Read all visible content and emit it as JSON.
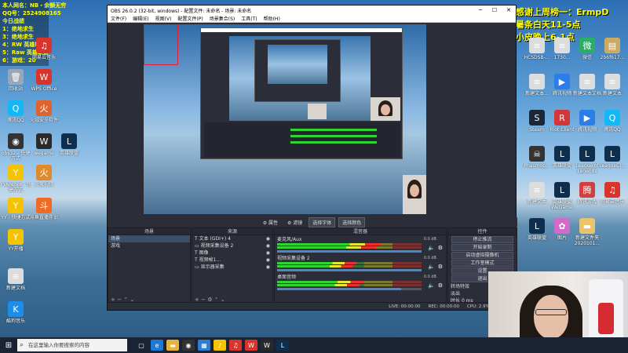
{
  "overlay_left": [
    "本人网名：NB・余额无穷",
    "QQ号：2524908165",
    "今日战绩",
    "1：绝地求生",
    "3：绝地求生",
    "4：RW 英雄联盟",
    "5：Raw 英雄联盟",
    "6：游戏：20"
  ],
  "overlay_right": [
    "感谢上周榜一：ErmpD",
    "暑条白天11-5点",
    "小皮晚上6-1点"
  ],
  "desktop_icons_left": [
    {
      "label": "回收站",
      "icon": "recycle-bin-icon",
      "color": "#9aa7b8",
      "glyph": "🗑"
    },
    {
      "label": "WPS Office",
      "icon": "wps-icon",
      "color": "#d9332b",
      "glyph": "W"
    },
    {
      "label": "网易云音乐",
      "icon": "netease-music-icon",
      "color": "#d9332b",
      "glyph": "♫"
    },
    {
      "label": "腾讯QQ",
      "icon": "qq-icon",
      "color": "#12b7f5",
      "glyph": "Q"
    },
    {
      "label": "火绒安全软件",
      "icon": "huorong-icon",
      "color": "#e0632e",
      "glyph": "火"
    },
    {
      "label": "obs32 - 快捷方式",
      "icon": "obs-icon",
      "color": "#333333",
      "glyph": "◉"
    },
    {
      "label": "wegame",
      "icon": "wegame-icon",
      "color": "#2a2a2a",
      "glyph": "W"
    },
    {
      "label": "英雄联盟",
      "icon": "league-icon",
      "color": "#0d2f4d",
      "glyph": "L"
    },
    {
      "label": "YYAnchor - 快捷方式",
      "icon": "yy-anchor-icon",
      "color": "#f5c300",
      "glyph": "Y"
    },
    {
      "label": "火萤视频",
      "icon": "firefly-icon",
      "color": "#e08a2e",
      "glyph": "火"
    },
    {
      "label": "YY - 快捷方式",
      "icon": "yy-icon",
      "color": "#f5c300",
      "glyph": "Y"
    },
    {
      "label": "斗鱼直播伴侣",
      "icon": "douyu-icon",
      "color": "#f06a23",
      "glyph": "斗"
    },
    {
      "label": "YY开播",
      "icon": "yy-live-icon",
      "color": "#f5c300",
      "glyph": "Y"
    },
    {
      "label": "新建文档",
      "icon": "doc-icon",
      "color": "#dddddd",
      "glyph": "≡"
    },
    {
      "label": "酷狗音乐",
      "icon": "kugou-icon",
      "color": "#1b8dea",
      "glyph": "K"
    }
  ],
  "desktop_icons_right": [
    {
      "label": "HCSDSB-...",
      "icon": "file-icon",
      "color": "#dddddd",
      "glyph": "≡"
    },
    {
      "label": "1730...",
      "icon": "file-icon-2",
      "color": "#dddddd",
      "glyph": "≡"
    },
    {
      "label": "微信",
      "icon": "wechat-icon",
      "color": "#2aae67",
      "glyph": "微"
    },
    {
      "label": "2b6f617...",
      "icon": "file-icon-3",
      "color": "#ccaa66",
      "glyph": "▤"
    },
    {
      "label": "新建文本...",
      "icon": "txt-icon",
      "color": "#dddddd",
      "glyph": "≡"
    },
    {
      "label": "腾讯视频",
      "icon": "tencent-video-icon",
      "color": "#2b7de9",
      "glyph": "▶"
    },
    {
      "label": "新建文本文档",
      "icon": "txt-icon-2",
      "color": "#dddddd",
      "glyph": "≡"
    },
    {
      "label": "新建文本",
      "icon": "txt-icon-3",
      "color": "#dddddd",
      "glyph": "≡"
    },
    {
      "label": "Steam",
      "icon": "steam-icon",
      "color": "#1b2838",
      "glyph": "S"
    },
    {
      "label": "Riot Client",
      "icon": "riot-icon",
      "color": "#d13639",
      "glyph": "R"
    },
    {
      "label": "腾讯视频",
      "icon": "tencent-video-icon-2",
      "color": "#2b7de9",
      "glyph": "▶"
    },
    {
      "label": "腾讯QQ",
      "icon": "qq-icon-2",
      "color": "#12b7f5",
      "glyph": "Q"
    },
    {
      "label": "Phasmop...",
      "icon": "phasmo-icon",
      "color": "#333333",
      "glyph": "☠"
    },
    {
      "label": "英雄联盟",
      "icon": "league-icon-2",
      "color": "#0d2f4d",
      "glyph": "L"
    },
    {
      "label": "League of Legends",
      "icon": "league-icon-3",
      "color": "#0d2f4d",
      "glyph": "L"
    },
    {
      "label": "LeagueCl...",
      "icon": "league-client-icon",
      "color": "#0d2f4d",
      "glyph": "L"
    },
    {
      "label": "新建文本",
      "icon": "txt-icon-4",
      "color": "#dddddd",
      "glyph": "≡"
    },
    {
      "label": "英雄联盟WeGame",
      "icon": "league-wegame-icon",
      "color": "#0d2f4d",
      "glyph": "L"
    },
    {
      "label": "腾讯游戏",
      "icon": "tencent-game-icon",
      "color": "#d23f3f",
      "glyph": "腾"
    },
    {
      "label": "网易云音乐",
      "icon": "netease-icon-2",
      "color": "#d9332b",
      "glyph": "♫"
    },
    {
      "label": "英雄联盟",
      "icon": "league-icon-4",
      "color": "#0d2f4d",
      "glyph": "L"
    },
    {
      "label": "图片",
      "icon": "image-icon",
      "color": "#d36ac9",
      "glyph": "✿"
    },
    {
      "label": "新建文件夹 2020101...",
      "icon": "folder-icon",
      "color": "#e9c46a",
      "glyph": "▬"
    }
  ],
  "obs": {
    "title": "OBS 26.0.2 (32-bit, windows) - 配置文件: 未命名 - 场景: 未命名",
    "menus": [
      "文件(F)",
      "编辑(E)",
      "视图(V)",
      "配置文件(P)",
      "场景集合(S)",
      "工具(T)",
      "帮助(H)"
    ],
    "source_toolbar": [
      "⚙ 属性",
      "⚙ 滤镜",
      "选择字体",
      "选择颜色"
    ],
    "scenes_header": "场景",
    "scenes": [
      "场景",
      "游戏"
    ],
    "sources_header": "来源",
    "sources": [
      "文本 (GDI+) 4",
      "视频采集设备 2",
      "图像",
      "视频帧1...",
      "显示器采集"
    ],
    "mixer_header": "混音器",
    "mixer": [
      {
        "name": "麦克风/Aux",
        "db": "0.0 dB",
        "level": 0.72,
        "volume": 1.0
      },
      {
        "name": "视频采集设备 2",
        "db": "0.0 dB",
        "level": 0.55,
        "volume": 1.0
      },
      {
        "name": "桌面音频",
        "db": "0.0 dB",
        "level": 0.6,
        "volume": 0.86
      }
    ],
    "controls_header": "控件",
    "controls": [
      "停止推流",
      "开始录制",
      "启动虚拟摄像机",
      "工作室模式",
      "设置",
      "退出"
    ],
    "transition_header": "转场特效",
    "transition_value": "淡出",
    "duration_label": "时长",
    "duration_value": "0 ms",
    "status": [
      "LIVE: 00:00:00",
      "REC: 00:00:00",
      "CPU: 2.9%, 30.00 fps"
    ]
  },
  "taskbar": {
    "search_placeholder": "在这里输入你要搜索的内容"
  },
  "taskbar_apps": [
    {
      "icon": "task-view-icon",
      "color": "#1b2434",
      "glyph": "▢"
    },
    {
      "icon": "edge-icon",
      "color": "#1d7bd8",
      "glyph": "e"
    },
    {
      "icon": "explorer-icon",
      "color": "#e6b43c",
      "glyph": "▬"
    },
    {
      "icon": "obs-task-icon",
      "color": "#333333",
      "glyph": "◉"
    },
    {
      "icon": "store-icon",
      "color": "#2d7dd2",
      "glyph": "▦"
    },
    {
      "icon": "qq-music-icon",
      "color": "#f5c300",
      "glyph": "♪"
    },
    {
      "icon": "netease-task-icon",
      "color": "#d9332b",
      "glyph": "♫"
    },
    {
      "icon": "wps-task-icon",
      "color": "#d9332b",
      "glyph": "W"
    },
    {
      "icon": "wegame-task-icon",
      "color": "#2a2a2a",
      "glyph": "W"
    },
    {
      "icon": "league-task-icon",
      "color": "#0d2f4d",
      "glyph": "L"
    }
  ]
}
